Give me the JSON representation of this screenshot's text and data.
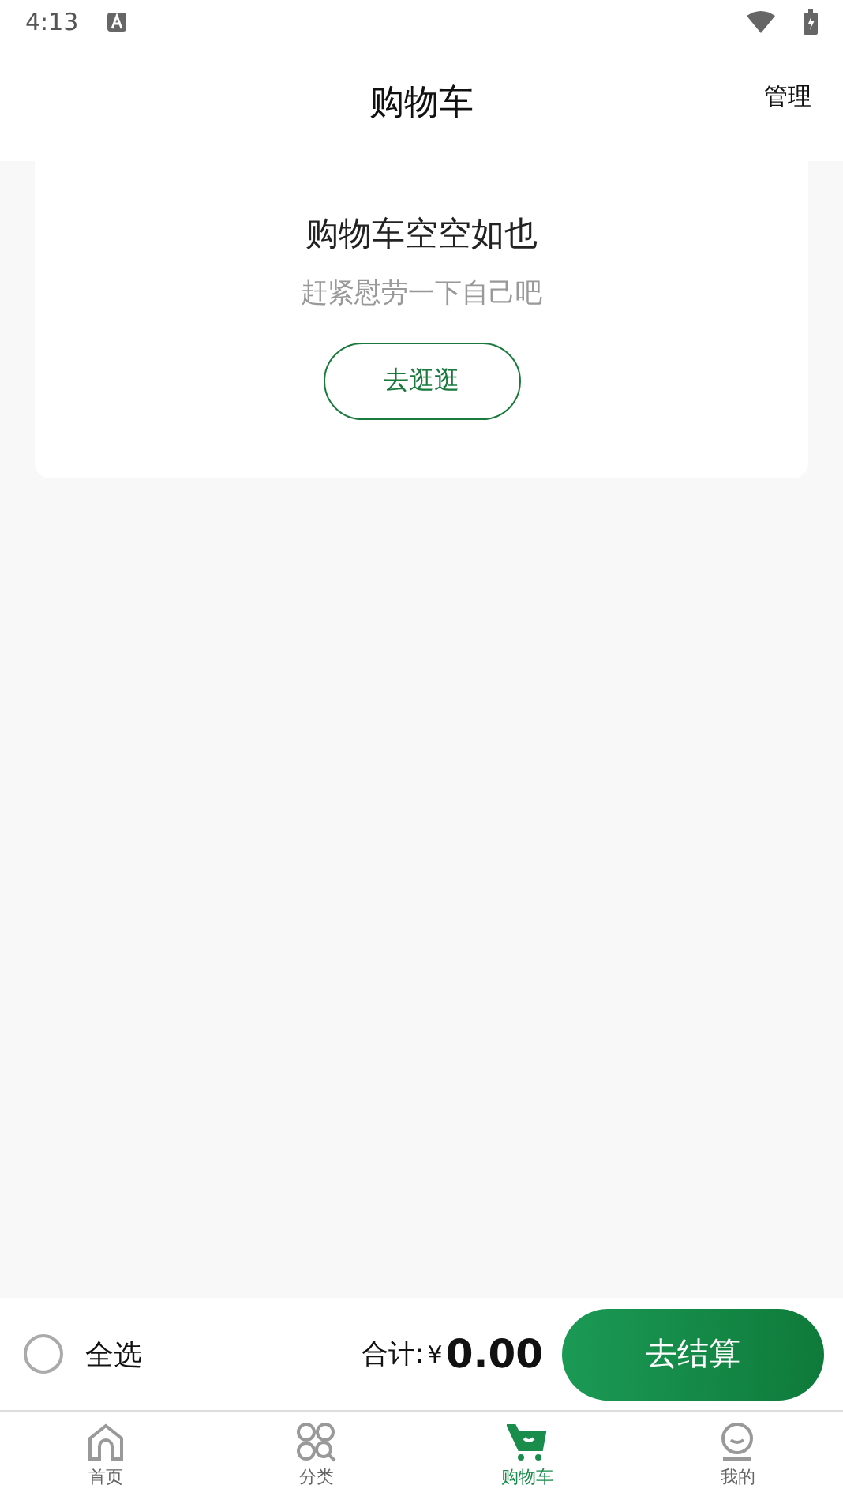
{
  "status_bar": {
    "time": "4:13"
  },
  "header": {
    "title": "购物车",
    "action": "管理"
  },
  "empty_state": {
    "title": "购物车空空如也",
    "subtitle": "赶紧慰劳一下自己吧",
    "button": "去逛逛"
  },
  "checkout_bar": {
    "select_all": {
      "label": "全选",
      "checked": false
    },
    "total_label": "合计:",
    "currency": "¥",
    "total": "0.00",
    "button": "去结算"
  },
  "tabs": [
    {
      "kind": "home",
      "label": "首页",
      "selected": false
    },
    {
      "kind": "category",
      "label": "分类",
      "selected": false
    },
    {
      "kind": "cart",
      "label": "购物车",
      "selected": true
    },
    {
      "kind": "profile",
      "label": "我的",
      "selected": false
    }
  ]
}
